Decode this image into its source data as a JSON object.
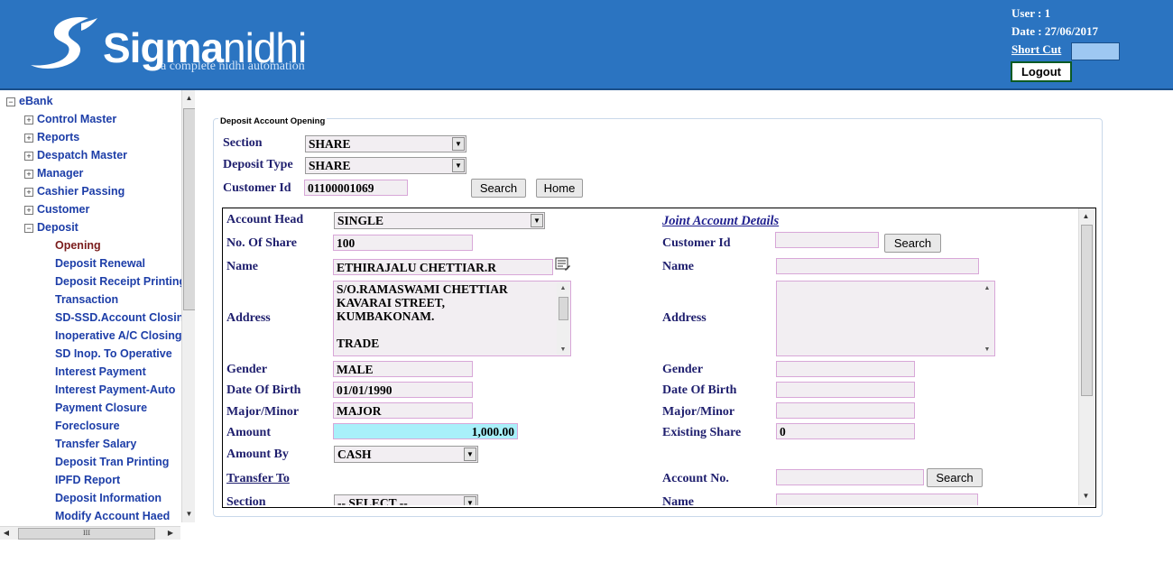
{
  "header": {
    "logo_word_bold": "Sigma",
    "logo_word_thin": "nidhi",
    "logo_tagline": "a complete nidhi automation",
    "user": "User : 1",
    "date": "Date : 27/06/2017",
    "shortcut_label": "Short Cut",
    "logout_label": "Logout",
    "colors": {
      "header_bg": "#2b74c1",
      "shortcut_bg": "#9ec8f2"
    }
  },
  "sidebar": {
    "root": "eBank",
    "groups": [
      "Control Master",
      "Reports",
      "Despatch Master",
      "Manager",
      "Cashier Passing",
      "Customer"
    ],
    "deposit_group": "Deposit",
    "deposit_items": [
      "Opening",
      "Deposit Renewal",
      "Deposit Receipt Printing",
      "Transaction",
      "SD-SSD.Account Closing",
      "Inoperative A/C Closing",
      "SD Inop. To Operative",
      "Interest Payment",
      "Interest Payment-Auto",
      "Payment Closure",
      "Foreclosure",
      "Transfer Salary",
      "Deposit Tran Printing",
      "IPFD Report",
      "Deposit Information",
      "Modify Account Haed"
    ],
    "selected_item": "Opening",
    "hscroll_grip": "III"
  },
  "form": {
    "title": "Deposit Account Opening",
    "section_label": "Section",
    "section_value": "SHARE",
    "deposit_type_label": "Deposit Type",
    "deposit_type_value": "SHARE",
    "customer_id_label": "Customer Id",
    "customer_id_value": "01100001069",
    "search_label": "Search",
    "home_label": "Home"
  },
  "details": {
    "account_head_label": "Account Head",
    "account_head_value": "SINGLE",
    "no_of_share_label": "No. Of Share",
    "no_of_share_value": "100",
    "name_label": "Name",
    "name_value": "ETHIRAJALU CHETTIAR.R",
    "address_label": "Address",
    "address_lines": [
      "S/O.RAMASWAMI CHETTIAR",
      "KAVARAI STREET,",
      "KUMBAKONAM.",
      "",
      "TRADE"
    ],
    "gender_label": "Gender",
    "gender_value": "MALE",
    "dob_label": "Date Of Birth",
    "dob_value": "01/01/1990",
    "major_minor_label": "Major/Minor",
    "major_minor_value": "MAJOR",
    "amount_label": "Amount",
    "amount_value": "1,000.00",
    "amount_by_label": "Amount By",
    "amount_by_value": "CASH",
    "transfer_to_label": "Transfer To",
    "section_label": "Section",
    "section_select_value": "-- SELECT --"
  },
  "joint": {
    "title": "Joint Account Details",
    "customer_id_label": "Customer Id",
    "customer_id_value": "",
    "search_label": "Search",
    "name_label": "Name",
    "name_value": "",
    "address_label": "Address",
    "gender_label": "Gender",
    "gender_value": "",
    "dob_label": "Date Of Birth",
    "dob_value": "",
    "major_minor_label": "Major/Minor",
    "major_minor_value": "",
    "existing_share_label": "Existing Share",
    "existing_share_value": "0",
    "account_no_label": "Account No.",
    "account_no_value": "",
    "account_search_label": "Search",
    "name2_label": "Name",
    "name2_value": ""
  }
}
